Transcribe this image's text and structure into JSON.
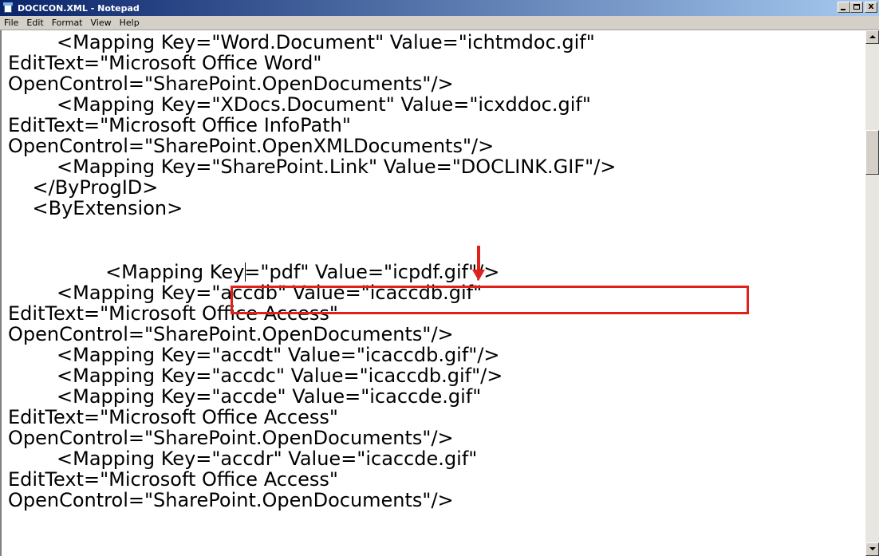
{
  "window": {
    "title": "DOCICON.XML - Notepad",
    "close_glyph": "x"
  },
  "menu": [
    "File",
    "Edit",
    "Format",
    "View",
    "Help"
  ],
  "document": {
    "lines": [
      "        <Mapping Key=\"Word.Document\" Value=\"ichtmdoc.gif\"",
      "EditText=\"Microsoft Office Word\"",
      "OpenControl=\"SharePoint.OpenDocuments\"/>",
      "        <Mapping Key=\"XDocs.Document\" Value=\"icxddoc.gif\"",
      "EditText=\"Microsoft Office InfoPath\"",
      "OpenControl=\"SharePoint.OpenXMLDocuments\"/>",
      "        <Mapping Key=\"SharePoint.Link\" Value=\"DOCLINK.GIF\"/>",
      "    </ByProgID>",
      "    <ByExtension>",
      "                <Mapping Key=\"pdf\" Value=\"icpdf.gif\"/>",
      "        <Mapping Key=\"accdb\" Value=\"icaccdb.gif\"",
      "EditText=\"Microsoft Office Access\"",
      "OpenControl=\"SharePoint.OpenDocuments\"/>",
      "        <Mapping Key=\"accdt\" Value=\"icaccdb.gif\"/>",
      "        <Mapping Key=\"accdc\" Value=\"icaccdb.gif\"/>",
      "        <Mapping Key=\"accde\" Value=\"icaccde.gif\"",
      "EditText=\"Microsoft Office Access\"",
      "OpenControl=\"SharePoint.OpenDocuments\"/>",
      "        <Mapping Key=\"accdr\" Value=\"icaccde.gif\"",
      "EditText=\"Microsoft Office Access\"",
      "OpenControl=\"SharePoint.OpenDocuments\"/>"
    ]
  },
  "annotation": {
    "color": "#e0201a",
    "highlighted_line_index": 9
  },
  "icons": {
    "app": "notepad-icon",
    "minimize": "minimize-icon",
    "maximize": "maximize-icon",
    "close": "close-icon",
    "scroll_up": "scroll-up-arrow-icon",
    "scroll_down": "scroll-down-arrow-icon",
    "annotation_arrow": "down-arrow-icon"
  }
}
